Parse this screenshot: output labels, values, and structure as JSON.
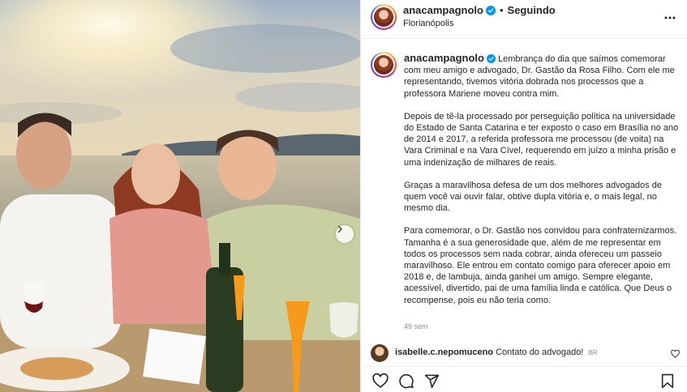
{
  "post": {
    "username": "anacampagnolo",
    "follow_label": "Seguindo",
    "separator": "•",
    "location": "Florianópolis",
    "caption_paragraphs": [
      "Lembrança do dia que saímos comemorar com meu amigo e advogado, Dr. Gastão da Rosa Filho. Com ele me representando, tivemos vitória dobrada nos processos que a professora Mariene moveu contra mim.",
      "Depois de tê-la processado por perseguição política na universidade do Estado de Santa Catarina e ter exposto o caso em Brasília no ano de 2014 e 2017, a referida professora me processou (de voita) na Vara Criminal e na Vara Cível, requerendo em juízo a minha prisão e uma indenização de milhares de reais.",
      "Graças a maravilhosa defesa de um dos melhores advogados de quem você vai ouvir falar, obtive dupla vitória e, o mais legal, no mesmo dia.",
      "Para comemorar, o Dr. Gastão nos convidou para confraternizarmos. Tamanha é a sua generosidade que, além de me representar em todos os processos sem nada cobrar, ainda ofereceu um passeio maravilhoso. Ele entrou em contato comigo para oferecer apoio em 2018 e, de lambuja, ainda ganhei um amigo. Sempre elegante, acessível, divertido, pai de uma família linda e católica. Que Deus o recompense, pois eu não teria como."
    ],
    "timestamp": "49 sem"
  },
  "comment": {
    "username": "isabelle.c.nepomuceno",
    "text": "Contato do advogado!",
    "badge": "BR"
  },
  "icons": {
    "verified": "verified-badge-icon",
    "more": "more-options-icon",
    "next": "chevron-right-icon",
    "like": "heart-icon",
    "comment": "comment-icon",
    "share": "send-icon",
    "save": "bookmark-icon"
  },
  "colors": {
    "verified_blue": "#0095f6",
    "text": "#262626",
    "muted": "#8e8e8e",
    "border": "#efefef"
  }
}
